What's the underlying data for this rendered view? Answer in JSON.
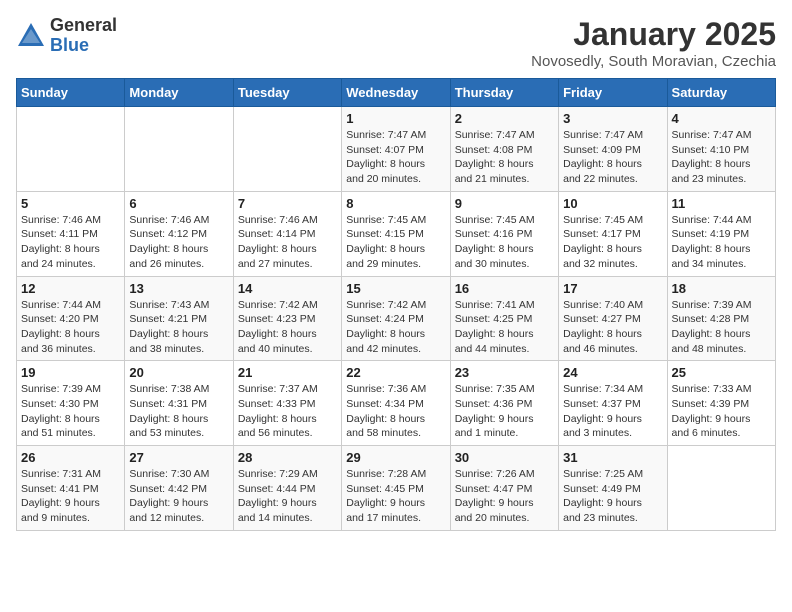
{
  "logo": {
    "general": "General",
    "blue": "Blue"
  },
  "title": "January 2025",
  "subtitle": "Novosedly, South Moravian, Czechia",
  "days_of_week": [
    "Sunday",
    "Monday",
    "Tuesday",
    "Wednesday",
    "Thursday",
    "Friday",
    "Saturday"
  ],
  "weeks": [
    [
      {
        "day": "",
        "info": ""
      },
      {
        "day": "",
        "info": ""
      },
      {
        "day": "",
        "info": ""
      },
      {
        "day": "1",
        "info": "Sunrise: 7:47 AM\nSunset: 4:07 PM\nDaylight: 8 hours\nand 20 minutes."
      },
      {
        "day": "2",
        "info": "Sunrise: 7:47 AM\nSunset: 4:08 PM\nDaylight: 8 hours\nand 21 minutes."
      },
      {
        "day": "3",
        "info": "Sunrise: 7:47 AM\nSunset: 4:09 PM\nDaylight: 8 hours\nand 22 minutes."
      },
      {
        "day": "4",
        "info": "Sunrise: 7:47 AM\nSunset: 4:10 PM\nDaylight: 8 hours\nand 23 minutes."
      }
    ],
    [
      {
        "day": "5",
        "info": "Sunrise: 7:46 AM\nSunset: 4:11 PM\nDaylight: 8 hours\nand 24 minutes."
      },
      {
        "day": "6",
        "info": "Sunrise: 7:46 AM\nSunset: 4:12 PM\nDaylight: 8 hours\nand 26 minutes."
      },
      {
        "day": "7",
        "info": "Sunrise: 7:46 AM\nSunset: 4:14 PM\nDaylight: 8 hours\nand 27 minutes."
      },
      {
        "day": "8",
        "info": "Sunrise: 7:45 AM\nSunset: 4:15 PM\nDaylight: 8 hours\nand 29 minutes."
      },
      {
        "day": "9",
        "info": "Sunrise: 7:45 AM\nSunset: 4:16 PM\nDaylight: 8 hours\nand 30 minutes."
      },
      {
        "day": "10",
        "info": "Sunrise: 7:45 AM\nSunset: 4:17 PM\nDaylight: 8 hours\nand 32 minutes."
      },
      {
        "day": "11",
        "info": "Sunrise: 7:44 AM\nSunset: 4:19 PM\nDaylight: 8 hours\nand 34 minutes."
      }
    ],
    [
      {
        "day": "12",
        "info": "Sunrise: 7:44 AM\nSunset: 4:20 PM\nDaylight: 8 hours\nand 36 minutes."
      },
      {
        "day": "13",
        "info": "Sunrise: 7:43 AM\nSunset: 4:21 PM\nDaylight: 8 hours\nand 38 minutes."
      },
      {
        "day": "14",
        "info": "Sunrise: 7:42 AM\nSunset: 4:23 PM\nDaylight: 8 hours\nand 40 minutes."
      },
      {
        "day": "15",
        "info": "Sunrise: 7:42 AM\nSunset: 4:24 PM\nDaylight: 8 hours\nand 42 minutes."
      },
      {
        "day": "16",
        "info": "Sunrise: 7:41 AM\nSunset: 4:25 PM\nDaylight: 8 hours\nand 44 minutes."
      },
      {
        "day": "17",
        "info": "Sunrise: 7:40 AM\nSunset: 4:27 PM\nDaylight: 8 hours\nand 46 minutes."
      },
      {
        "day": "18",
        "info": "Sunrise: 7:39 AM\nSunset: 4:28 PM\nDaylight: 8 hours\nand 48 minutes."
      }
    ],
    [
      {
        "day": "19",
        "info": "Sunrise: 7:39 AM\nSunset: 4:30 PM\nDaylight: 8 hours\nand 51 minutes."
      },
      {
        "day": "20",
        "info": "Sunrise: 7:38 AM\nSunset: 4:31 PM\nDaylight: 8 hours\nand 53 minutes."
      },
      {
        "day": "21",
        "info": "Sunrise: 7:37 AM\nSunset: 4:33 PM\nDaylight: 8 hours\nand 56 minutes."
      },
      {
        "day": "22",
        "info": "Sunrise: 7:36 AM\nSunset: 4:34 PM\nDaylight: 8 hours\nand 58 minutes."
      },
      {
        "day": "23",
        "info": "Sunrise: 7:35 AM\nSunset: 4:36 PM\nDaylight: 9 hours\nand 1 minute."
      },
      {
        "day": "24",
        "info": "Sunrise: 7:34 AM\nSunset: 4:37 PM\nDaylight: 9 hours\nand 3 minutes."
      },
      {
        "day": "25",
        "info": "Sunrise: 7:33 AM\nSunset: 4:39 PM\nDaylight: 9 hours\nand 6 minutes."
      }
    ],
    [
      {
        "day": "26",
        "info": "Sunrise: 7:31 AM\nSunset: 4:41 PM\nDaylight: 9 hours\nand 9 minutes."
      },
      {
        "day": "27",
        "info": "Sunrise: 7:30 AM\nSunset: 4:42 PM\nDaylight: 9 hours\nand 12 minutes."
      },
      {
        "day": "28",
        "info": "Sunrise: 7:29 AM\nSunset: 4:44 PM\nDaylight: 9 hours\nand 14 minutes."
      },
      {
        "day": "29",
        "info": "Sunrise: 7:28 AM\nSunset: 4:45 PM\nDaylight: 9 hours\nand 17 minutes."
      },
      {
        "day": "30",
        "info": "Sunrise: 7:26 AM\nSunset: 4:47 PM\nDaylight: 9 hours\nand 20 minutes."
      },
      {
        "day": "31",
        "info": "Sunrise: 7:25 AM\nSunset: 4:49 PM\nDaylight: 9 hours\nand 23 minutes."
      },
      {
        "day": "",
        "info": ""
      }
    ]
  ]
}
